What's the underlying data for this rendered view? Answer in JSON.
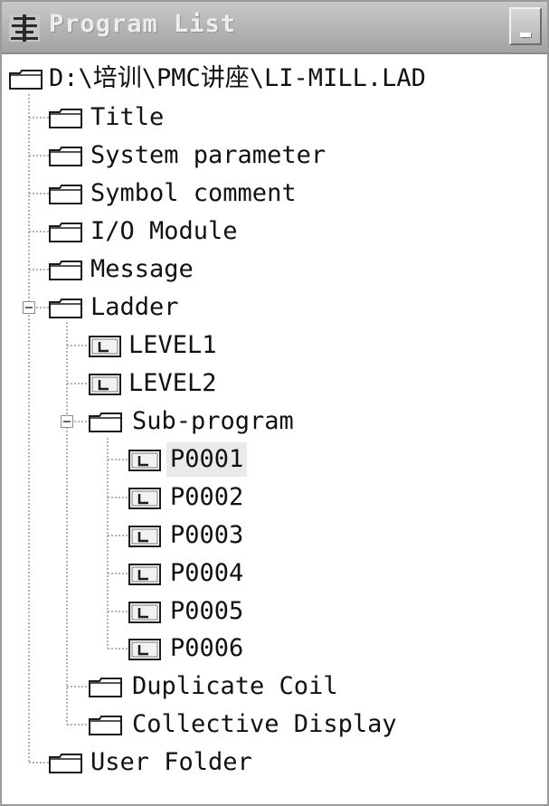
{
  "window": {
    "title": "Program List",
    "icon": "program-list-icon"
  },
  "tree": {
    "root": {
      "label": "D:\\培训\\PMC讲座\\LI-MILL.LAD",
      "icon": "folder-icon"
    },
    "items": [
      {
        "label": "Title",
        "icon": "folder-icon"
      },
      {
        "label": "System parameter",
        "icon": "folder-icon"
      },
      {
        "label": "Symbol comment",
        "icon": "folder-icon"
      },
      {
        "label": "I/O Module",
        "icon": "folder-icon"
      },
      {
        "label": "Message",
        "icon": "folder-icon"
      },
      {
        "label": "Ladder",
        "icon": "folder-icon",
        "expanded": true
      },
      {
        "label": "User Folder",
        "icon": "folder-icon"
      }
    ],
    "ladder_children": [
      {
        "label": "LEVEL1",
        "icon": "ladder-icon"
      },
      {
        "label": "LEVEL2",
        "icon": "ladder-icon"
      },
      {
        "label": "Sub-program",
        "icon": "folder-icon",
        "expanded": true
      },
      {
        "label": "Duplicate Coil",
        "icon": "folder-icon"
      },
      {
        "label": "Collective Display",
        "icon": "folder-icon"
      }
    ],
    "subprograms": [
      {
        "label": "P0001",
        "icon": "ladder-icon",
        "selected": true
      },
      {
        "label": "P0002",
        "icon": "ladder-icon"
      },
      {
        "label": "P0003",
        "icon": "ladder-icon"
      },
      {
        "label": "P0004",
        "icon": "ladder-icon"
      },
      {
        "label": "P0005",
        "icon": "ladder-icon"
      },
      {
        "label": "P0006",
        "icon": "ladder-icon"
      }
    ]
  }
}
